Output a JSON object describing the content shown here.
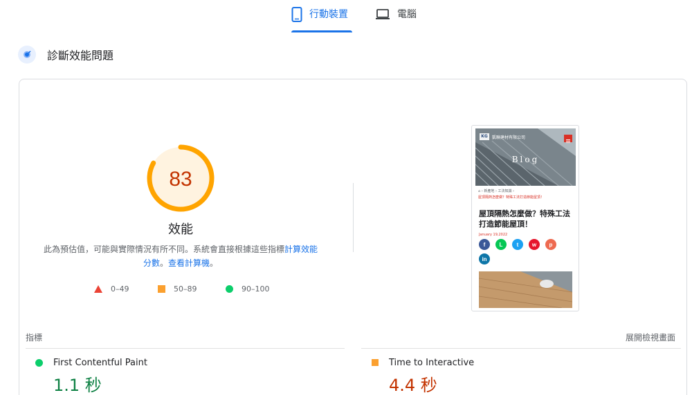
{
  "tabs": {
    "mobile_label": "行動裝置",
    "desktop_label": "電腦"
  },
  "section": {
    "title": "診斷效能問題"
  },
  "score": {
    "value": 83,
    "label": "效能",
    "ring_color": "#ffa400",
    "text_color": "#c33300",
    "fill_color": "#fff3e0"
  },
  "note": {
    "text": "此為預估值，可能與實際情況有所不同。系統會直接根據這些指標",
    "link1": "計算效能分數",
    "mid": "。",
    "link2": "查看計算機",
    "end": "。"
  },
  "legend": {
    "poor": "0–49",
    "average": "50–89",
    "good": "90–100"
  },
  "preview": {
    "logo": "KG",
    "company": "凱聯建材有限公司",
    "hero_title": "Blog",
    "crumb": "⌂ › 新產地 › 工法知識 ›",
    "crumb_red": "屋頂隔熱怎麼做？特殊工法打造節能屋頂！",
    "post_title": "屋頂隔熱怎麼做？特殊工法打造節能屋頂！",
    "post_date": "January 19,2022",
    "share": [
      {
        "icon": "f",
        "color": "#3b5998"
      },
      {
        "icon": "L",
        "color": "#06c755"
      },
      {
        "icon": "t",
        "color": "#1da1f2"
      },
      {
        "icon": "w",
        "color": "#e6162d"
      },
      {
        "icon": "p",
        "color": "#ee6a50"
      },
      {
        "icon": "in",
        "color": "#0e76a8"
      }
    ]
  },
  "metrics": {
    "header": "指標",
    "expand": "展開檢視畫面",
    "fcp": {
      "name": "First Contentful Paint",
      "value": "1.1 秒",
      "color": "#0d8043"
    },
    "tti": {
      "name": "Time to Interactive",
      "value": "4.4 秒",
      "color": "#c33300"
    }
  }
}
